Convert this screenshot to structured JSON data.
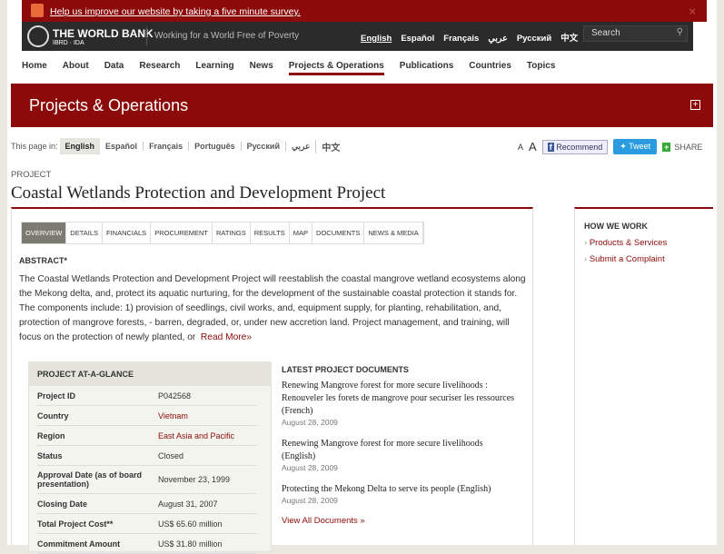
{
  "survey": {
    "text": "Help us improve our website by taking a five minute survey.",
    "close": "×"
  },
  "header": {
    "brand": "THE WORLD BANK",
    "sub": "IBRD · IDA",
    "tagline": "Working for a World Free of Poverty",
    "languages": [
      "English",
      "Español",
      "Français",
      "عربي",
      "Русский",
      "中文",
      "▸"
    ],
    "search_placeholder": "Search"
  },
  "nav": [
    "Home",
    "About",
    "Data",
    "Research",
    "Learning",
    "News",
    "Projects & Operations",
    "Publications",
    "Countries",
    "Topics"
  ],
  "banner": {
    "title": "Projects & Operations",
    "plus": "+"
  },
  "page_in": {
    "label": "This page in:",
    "languages": [
      "English",
      "Español",
      "Français",
      "Português",
      "Русский",
      "عربي",
      "中文"
    ]
  },
  "tools": {
    "font_small": "A",
    "font_large": "A",
    "recommend": "Recommend",
    "tweet": "Tweet",
    "share": "SHARE",
    "share_icon": "+"
  },
  "project": {
    "kicker": "PROJECT",
    "title": "Coastal Wetlands Protection and Development Project"
  },
  "tabs": [
    "OVERVIEW",
    "DETAILS",
    "FINANCIALS",
    "PROCUREMENT",
    "RATINGS",
    "RESULTS",
    "MAP",
    "DOCUMENTS",
    "NEWS & MEDIA"
  ],
  "abstract": {
    "heading": "ABSTRACT*",
    "text": "The Coastal Wetlands Protection and Development Project will reestablish the coastal mangrove wetland ecosystems along the Mekong delta, and, protect its aquatic nurturing, for the development of the sustainable coastal protection it stands for. The components include: 1) provision of seedlings, civil works, and, equipment supply, for planting, rehabilitation, and, protection of mangrove forests, - barren, degraded, or, under new accretion land. Project management, and training, will focus on the protection of newly planted, or",
    "more": "Read More»"
  },
  "glance": {
    "heading": "PROJECT AT-A-GLANCE",
    "rows": [
      {
        "k": "Project ID",
        "v": "P042568"
      },
      {
        "k": "Country",
        "v": "Vietnam"
      },
      {
        "k": "Region",
        "v": "East Asia and Pacific"
      },
      {
        "k": "Status",
        "v": "Closed"
      },
      {
        "k": "Approval Date (as of board presentation)",
        "v": "November 23, 1999"
      },
      {
        "k": "Closing Date",
        "v": "August 31, 2007"
      },
      {
        "k": "Total Project Cost**",
        "v": "US$ 65.60  million"
      },
      {
        "k": "Commitment Amount",
        "v": "US$ 31.80  million"
      }
    ]
  },
  "documents": {
    "heading": "LATEST PROJECT DOCUMENTS",
    "items": [
      {
        "t": "Renewing Mangrove forest for more secure livelihoods : Renouveler les forets de mangrove pour securiser les ressources (French)",
        "d": "August 28, 2009"
      },
      {
        "t": "Renewing Mangrove forest for more secure livelihoods (English)",
        "d": "August 28, 2009"
      },
      {
        "t": "Protecting the Mekong Delta to serve its people (English)",
        "d": "August 28, 2009"
      }
    ],
    "all": "View All Documents »"
  },
  "sidebar": {
    "heading": "HOW WE WORK",
    "links": [
      "Products & Services",
      "Submit a Complaint"
    ]
  }
}
